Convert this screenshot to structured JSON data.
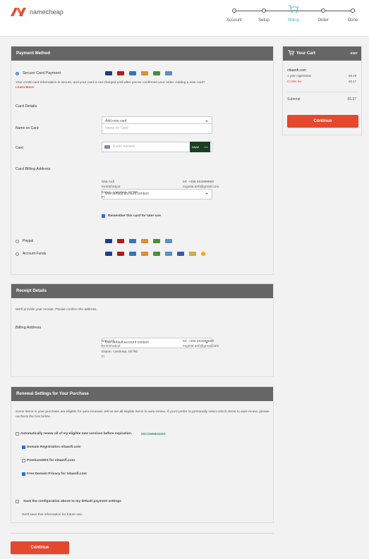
{
  "brand": {
    "name": "namecheap",
    "accent": "#e4482d"
  },
  "steps": [
    {
      "label": "Account",
      "icon": "step-dot"
    },
    {
      "label": "Setup",
      "icon": "step-dot"
    },
    {
      "label": "Billing",
      "icon": "cart-icon",
      "active": true
    },
    {
      "label": "Order",
      "icon": "step-dot"
    },
    {
      "label": "Done",
      "icon": "step-dot"
    }
  ],
  "payment": {
    "title": "Payment Method",
    "secure_card_label": "Secure Card Payment",
    "info": "Your credit card information is secure, and your card is not charged until after you've confirmed your order. Adding a new card?",
    "learn_more": "Learn More",
    "card_details_label": "Card Details",
    "card_details_value": "Add new card",
    "name_on_card_label": "Name on Card",
    "name_on_card_placeholder": "Name on Card",
    "card_label": "Card",
    "card_placeholder": "Kortin numero",
    "card_pill_text": "Käytä",
    "card_pill_link": "link",
    "billing_address_label": "Card Billing Address",
    "billing_address_value": "Use default account contact",
    "address": [
      "Nita Anfi",
      "Kirstinharju4",
      "Espoo, Uusimaa, 02760",
      "FI"
    ],
    "tel": "tel: +358.452099669",
    "email": "evgnita.anfi@gmail.com",
    "remember_label": "Remember this card for later use",
    "paypal_label": "Paypal",
    "funds_label": "Account Funds"
  },
  "receipt": {
    "title": "Receipt Details",
    "intro": "We'll provide your receipt. Please confirm the address.",
    "billing_label": "Billing Address",
    "billing_value": "Use default account contact",
    "address": [
      "Nita Anfi",
      "Kirstinharju4",
      "Espoo, Uusimaa, 02760",
      "FI"
    ],
    "tel": "tel: +358.452099669",
    "email": "evgnita.anfi@gmail.com"
  },
  "renewal": {
    "title": "Renewal Settings for Your Purchase",
    "intro": "Some items in your purchase are eligible for auto-renewal. We've set all eligible items to auto-renew. If you'd prefer to personally select which items to auto-renew, please uncheck the box below.",
    "auto_renew_label": "Automatically renew all of my eligible new services before expiration.",
    "recommended": "RECOMMENDED",
    "items": [
      {
        "label": "Domain Registration nitaanfi.com",
        "checked": true
      },
      {
        "label": "PremiumDNS for nitaanfi.com",
        "checked": false
      },
      {
        "label": "Free Domain Privacy for nitaanfi.com",
        "checked": true
      }
    ],
    "save_label": "Save the configuration above to my default payment settings",
    "save_note": "We'll save this information for future use."
  },
  "continue_label": "Continue",
  "cart": {
    "title": "Your Cart",
    "edit": "EDIT",
    "domain": "nitaanfi.com",
    "lines": [
      {
        "label": "1 year registration",
        "price": "€6.19"
      },
      {
        "label": "ICANN fee",
        "price": "€0.17"
      }
    ],
    "subtotal_label": "Subtotal",
    "subtotal_value": "€6.37",
    "continue_label": "Continue"
  }
}
